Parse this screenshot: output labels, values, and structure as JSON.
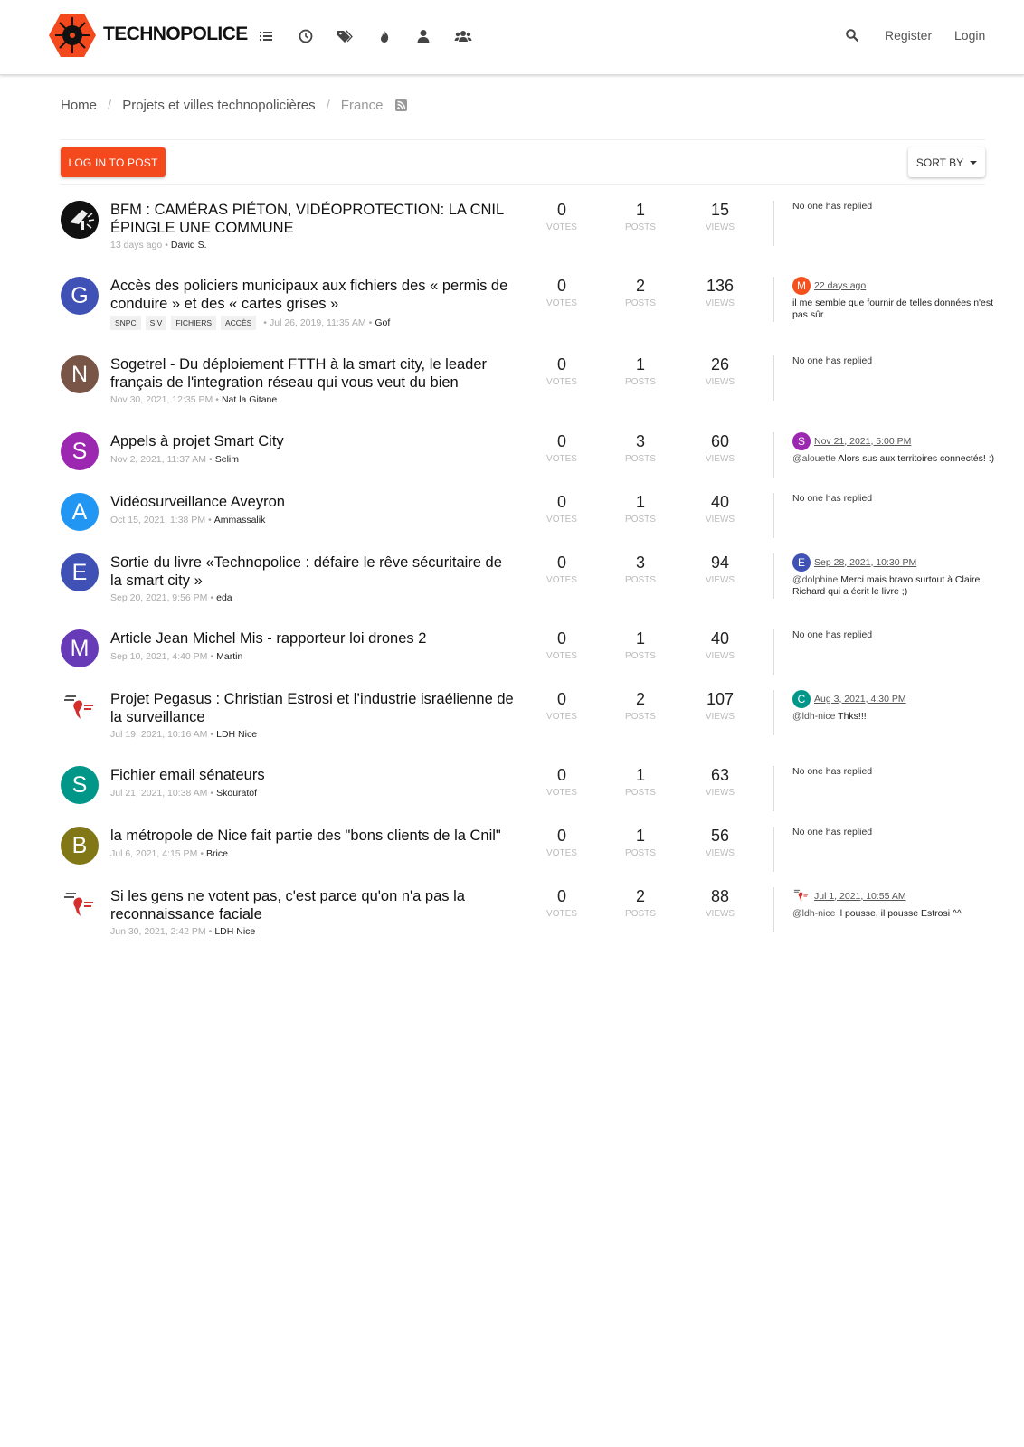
{
  "header": {
    "brand": "TECHNOPOLICE",
    "nav_icons": [
      "list-icon",
      "clock-icon",
      "tags-icon",
      "fire-icon",
      "user-icon",
      "users-icon"
    ],
    "search_icon": "search-icon",
    "register": "Register",
    "login": "Login",
    "accent": "#f4491c"
  },
  "breadcrumb": {
    "home": "Home",
    "category": "Projets et villes technopolicières",
    "current": "France",
    "sep": "/"
  },
  "toolbar": {
    "log_in_to_post": "LOG IN TO POST",
    "sort_by": "SORT BY"
  },
  "labels": {
    "votes": "VOTES",
    "posts": "POSTS",
    "views": "VIEWS",
    "no_reply": "No one has replied"
  },
  "topics": [
    {
      "title": "BFM : CAMÉRAS PIÉTON, VIDÉOPROTECTION: LA CNIL ÉPINGLE UNE COMMUNE",
      "time": "13 days ago",
      "author": "David S.",
      "avatar": "",
      "avatar_color": "#111111",
      "votes": "0",
      "posts": "1",
      "views": "15",
      "teaser": null
    },
    {
      "title": "Accès des policiers municipaux aux fichiers des « permis de conduire » et des « cartes grises »",
      "tags": [
        "SNPC",
        "SIV",
        "FICHIERS",
        "ACCÈS"
      ],
      "time": "Jul 26, 2019, 11:35 AM",
      "author": "Gof",
      "avatar": "G",
      "avatar_color": "#3f51b5",
      "votes": "0",
      "posts": "2",
      "views": "136",
      "teaser": {
        "avatar": "M",
        "color": "#f4511e",
        "time": "22 days ago",
        "mention": "",
        "text": "il me semble que fournir de telles données n'est pas sûr"
      }
    },
    {
      "title": "Sogetrel - Du déploiement FTTH à la smart city, le leader français de l'integration réseau qui vous veut du bien",
      "time": "Nov 30, 2021, 12:35 PM",
      "author": "Nat la Gitane",
      "avatar": "N",
      "avatar_color": "#795548",
      "votes": "0",
      "posts": "1",
      "views": "26",
      "teaser": null
    },
    {
      "title": "Appels à projet Smart City",
      "time": "Nov 2, 2021, 11:37 AM",
      "author": "Selim",
      "avatar": "S",
      "avatar_color": "#9c27b0",
      "votes": "0",
      "posts": "3",
      "views": "60",
      "teaser": {
        "avatar": "S",
        "color": "#9c27b0",
        "time": "Nov 21, 2021, 5:00 PM",
        "mention": "@alouette",
        "text": " Alors sus aux territoires connectés! :)"
      }
    },
    {
      "title": "Vidéosurveillance Aveyron",
      "time": "Oct 15, 2021, 1:38 PM",
      "author": "Ammassalik",
      "avatar": "A",
      "avatar_color": "#2196f3",
      "votes": "0",
      "posts": "1",
      "views": "40",
      "teaser": null
    },
    {
      "title": "Sortie du livre «Technopolice : défaire le rêve sécuritaire de la smart city »",
      "time": "Sep 20, 2021, 9:56 PM",
      "author": "eda",
      "avatar": "E",
      "avatar_color": "#3f51b5",
      "votes": "0",
      "posts": "3",
      "views": "94",
      "teaser": {
        "avatar": "E",
        "color": "#3f51b5",
        "time": "Sep 28, 2021, 10:30 PM",
        "mention": "@dolphine",
        "text": " Merci mais bravo surtout à Claire Richard qui a écrit le livre ;)"
      }
    },
    {
      "title": "Article Jean Michel Mis - rapporteur loi drones 2",
      "time": "Sep 10, 2021, 4:40 PM",
      "author": "Martin",
      "avatar": "M",
      "avatar_color": "#673ab7",
      "votes": "0",
      "posts": "1",
      "views": "40",
      "teaser": null
    },
    {
      "title": "Projet Pegasus : Christian Estrosi et l’industrie israélienne de la surveillance",
      "time": "Jul 19, 2021, 10:16 AM",
      "author": "LDH Nice",
      "avatar": "",
      "avatar_color": "#ffffff",
      "votes": "0",
      "posts": "2",
      "views": "107",
      "teaser": {
        "avatar": "C",
        "color": "#009688",
        "time": "Aug 3, 2021, 4:30 PM",
        "mention": "@ldh-nice",
        "text": " Thks!!!"
      }
    },
    {
      "title": "Fichier email sénateurs",
      "time": "Jul 21, 2021, 10:38 AM",
      "author": "Skouratof",
      "avatar": "S",
      "avatar_color": "#009688",
      "votes": "0",
      "posts": "1",
      "views": "63",
      "teaser": null
    },
    {
      "title": "la métropole de Nice fait partie des \"bons clients de la Cnil\"",
      "time": "Jul 6, 2021, 4:15 PM",
      "author": "Brice",
      "avatar": "B",
      "avatar_color": "#827717",
      "votes": "0",
      "posts": "1",
      "views": "56",
      "teaser": null
    },
    {
      "title": "Si les gens ne votent pas, c'est parce qu'on n'a pas la reconnaissance faciale",
      "time": "Jun 30, 2021, 2:42 PM",
      "author": "LDH Nice",
      "avatar": "",
      "avatar_color": "#ffffff",
      "votes": "0",
      "posts": "2",
      "views": "88",
      "teaser": {
        "avatar": "",
        "color": "#ffffff",
        "time": "Jul 1, 2021, 10:55 AM",
        "mention": "@ldh-nice",
        "text": " il pousse, il pousse Estrosi ^^"
      }
    }
  ]
}
